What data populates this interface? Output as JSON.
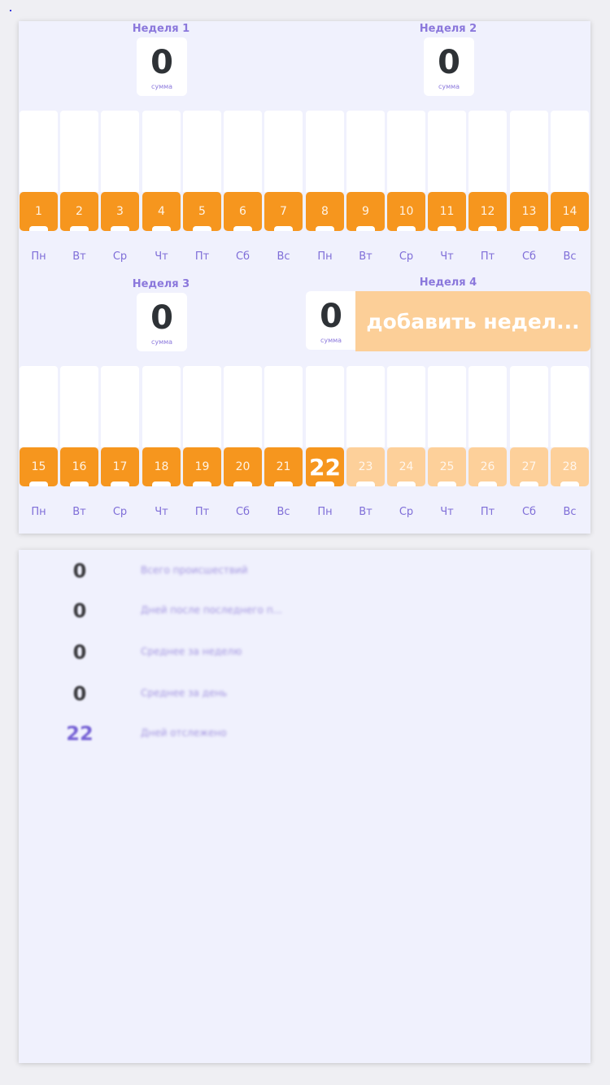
{
  "weeks": [
    {
      "label": "Неделя 1",
      "sum": "0",
      "sum_caption": "сумма"
    },
    {
      "label": "Неделя 2",
      "sum": "0",
      "sum_caption": "сумма"
    },
    {
      "label": "Неделя 3",
      "sum": "0",
      "sum_caption": "сумма"
    },
    {
      "label": "Неделя 4",
      "sum": "0",
      "sum_caption": "сумма"
    }
  ],
  "add_week_label": "добавить недел...",
  "day_names": [
    "Пн",
    "Вт",
    "Ср",
    "Чт",
    "Пт",
    "Сб",
    "Вс",
    "Пн",
    "Вт",
    "Ср",
    "Чт",
    "Пт",
    "Сб",
    "Вс"
  ],
  "days_row1": [
    "1",
    "2",
    "3",
    "4",
    "5",
    "6",
    "7",
    "8",
    "9",
    "10",
    "11",
    "12",
    "13",
    "14"
  ],
  "days_row2": [
    "15",
    "16",
    "17",
    "18",
    "19",
    "20",
    "21",
    "22",
    "23",
    "24",
    "25",
    "26",
    "27",
    "28"
  ],
  "today": "22",
  "stats": [
    {
      "value": "0",
      "label": "Всего происшествий"
    },
    {
      "value": "0",
      "label": "Дней после последнего п..."
    },
    {
      "value": "0",
      "label": "Среднее за неделю"
    },
    {
      "value": "0",
      "label": "Среднее за день"
    },
    {
      "value": "22",
      "label": "Дней отслежено"
    }
  ],
  "colors": {
    "accent_orange": "#f6961e",
    "future_orange": "#fdd09a",
    "purple_text": "#8b78dc",
    "card_bg": "#f0f1fd"
  }
}
